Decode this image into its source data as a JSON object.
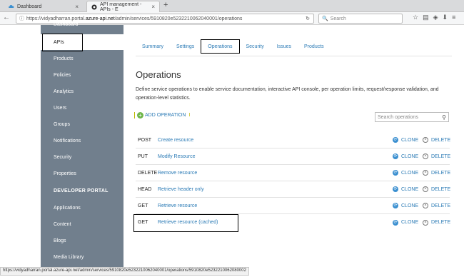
{
  "browser": {
    "tabs": [
      {
        "label": "Dashboard",
        "icon": "cloud-icon"
      },
      {
        "label": "API management - APIs - E",
        "icon": "azure-icon"
      }
    ],
    "url_prefix": "https://vidyadharran.portal.",
    "url_host": "azure-api.net",
    "url_path": "/admin/services/5910820e5232210062040001/operations",
    "search_placeholder": "Search",
    "status_url": "https://vidyadharran.portal.azure-api.net/admin/services/5910820e5232210062040001/operations/5910820e5232210062080002"
  },
  "sidebar": {
    "items": [
      {
        "label": "Dashboard"
      },
      {
        "label": "APIs",
        "active": true
      },
      {
        "label": "Products"
      },
      {
        "label": "Policies"
      },
      {
        "label": "Analytics"
      },
      {
        "label": "Users"
      },
      {
        "label": "Groups"
      },
      {
        "label": "Notifications"
      },
      {
        "label": "Security"
      },
      {
        "label": "Properties"
      },
      {
        "label": "DEVELOPER PORTAL",
        "section": true
      },
      {
        "label": "Applications"
      },
      {
        "label": "Content"
      },
      {
        "label": "Blogs"
      },
      {
        "label": "Media Library"
      }
    ]
  },
  "main": {
    "tabs": [
      {
        "label": "Summary"
      },
      {
        "label": "Settings"
      },
      {
        "label": "Operations",
        "active": true
      },
      {
        "label": "Security"
      },
      {
        "label": "Issues"
      },
      {
        "label": "Products"
      }
    ],
    "title": "Operations",
    "description": "Define service operations to enable service documentation, interactive API console, per operation limits, request/response validation, and operation-level statistics.",
    "add_label": "ADD OPERATION",
    "search_placeholder": "Search operations",
    "clone_label": "CLONE",
    "delete_label": "DELETE",
    "operations": [
      {
        "verb": "POST",
        "name": "Create resource"
      },
      {
        "verb": "PUT",
        "name": "Modify Resource"
      },
      {
        "verb": "DELETE",
        "name": "Remove resource"
      },
      {
        "verb": "HEAD",
        "name": "Retrieve header only"
      },
      {
        "verb": "GET",
        "name": "Retrieve resource"
      },
      {
        "verb": "GET",
        "name": "Retrieve resource (cached)"
      }
    ]
  },
  "colors": {
    "sidebar_bg": "#717f8d",
    "link": "#2a7ab5",
    "add_icon": "#6fb64b"
  }
}
